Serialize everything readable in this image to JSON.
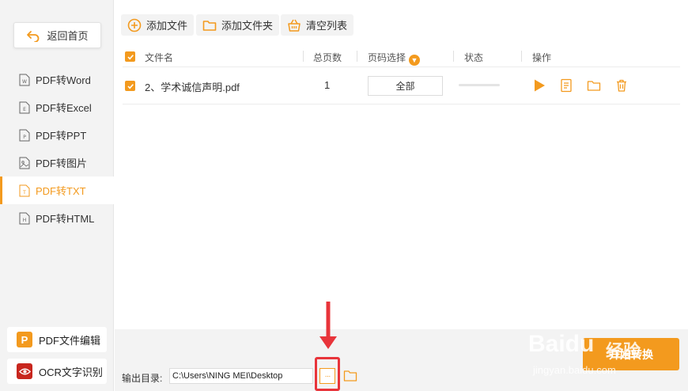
{
  "sidebar": {
    "back_label": "返回首页",
    "items": [
      {
        "label": "PDF转Word",
        "icon": "W"
      },
      {
        "label": "PDF转Excel",
        "icon": "E"
      },
      {
        "label": "PDF转PPT",
        "icon": "P"
      },
      {
        "label": "PDF转图片",
        "icon": "image"
      },
      {
        "label": "PDF转TXT",
        "icon": "T",
        "active": true
      },
      {
        "label": "PDF转HTML",
        "icon": "H"
      }
    ],
    "tools": [
      {
        "label": "PDF文件编辑",
        "icon": "P"
      },
      {
        "label": "OCR文字识别",
        "icon": "eye-icon"
      }
    ]
  },
  "toolbar": {
    "add_file": "添加文件",
    "add_folder": "添加文件夹",
    "clear_list": "清空列表"
  },
  "table": {
    "headers": {
      "filename": "文件名",
      "pages": "总页数",
      "page_select": "页码选择",
      "status": "状态",
      "actions": "操作"
    },
    "rows": [
      {
        "filename": "2、学术诚信声明.pdf",
        "pages": "1",
        "page_select": "全部",
        "checked": true
      }
    ]
  },
  "footer": {
    "output_label": "输出目录:",
    "output_path": "C:\\Users\\NING MEI\\Desktop",
    "browse_label": "···",
    "start_label": "开始转换"
  },
  "watermark": {
    "brand": "Baidu",
    "cn": "经验",
    "url": "jingyan.baidu.com"
  },
  "colors": {
    "accent": "#f39a1e",
    "highlight": "#e8343a",
    "ocr_icon": "#c8261e"
  }
}
